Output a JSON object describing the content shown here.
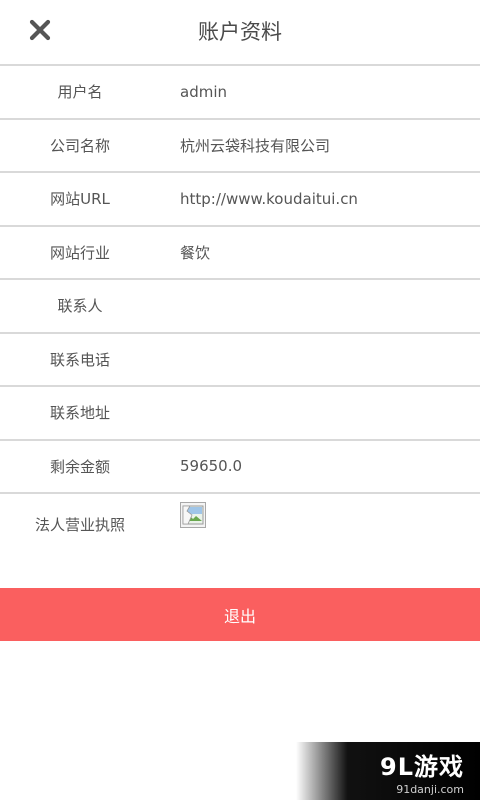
{
  "header": {
    "title": "账户资料",
    "close_icon": "close-icon"
  },
  "rows": [
    {
      "label": "用户名",
      "value": "admin"
    },
    {
      "label": "公司名称",
      "value": "杭州云袋科技有限公司"
    },
    {
      "label": "网站URL",
      "value": "http://www.koudaitui.cn"
    },
    {
      "label": "网站行业",
      "value": "餐饮"
    },
    {
      "label": "联系人",
      "value": ""
    },
    {
      "label": "联系电话",
      "value": ""
    },
    {
      "label": "联系地址",
      "value": ""
    },
    {
      "label": "剩余金额",
      "value": "59650.0"
    }
  ],
  "license": {
    "label": "法人营业执照",
    "image_icon": "broken-image-icon"
  },
  "logout": {
    "label": "退出"
  },
  "watermark": {
    "logo": "9L游戏",
    "url": "91danji.com"
  },
  "colors": {
    "accent": "#fa5f5f",
    "divider": "#d9d9d9",
    "text": "#555555"
  }
}
